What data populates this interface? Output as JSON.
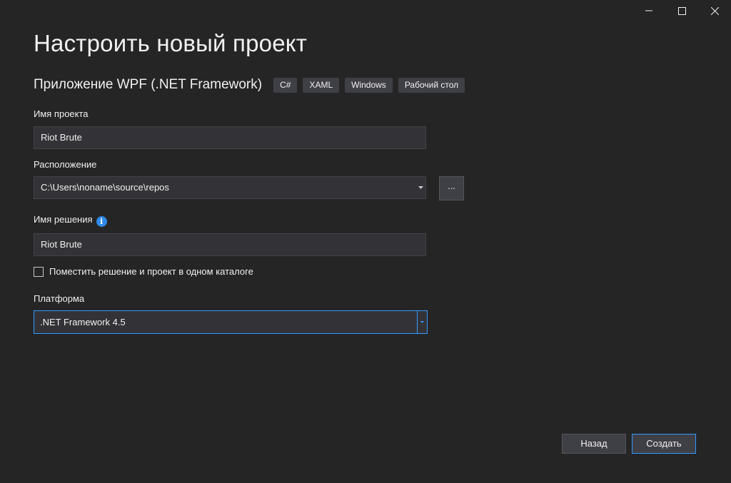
{
  "window": {
    "controls": [
      "minimize",
      "maximize",
      "close"
    ]
  },
  "page_title": "Настроить новый проект",
  "template": {
    "name": "Приложение WPF (.NET Framework)",
    "tags": [
      "C#",
      "XAML",
      "Windows",
      "Рабочий стол"
    ]
  },
  "project_name": {
    "label": "Имя проекта",
    "value": "Riot Brute"
  },
  "location": {
    "label": "Расположение",
    "value": "C:\\Users\\noname\\source\\repos",
    "browse_label": "..."
  },
  "solution_name": {
    "label": "Имя решения",
    "info_icon": "i",
    "value": "Riot Brute"
  },
  "same_directory": {
    "label": "Поместить решение и проект в одном каталоге",
    "checked": false
  },
  "platform": {
    "label": "Платформа",
    "value": ".NET Framework 4.5"
  },
  "buttons": {
    "back": "Назад",
    "create": "Создать"
  },
  "colors": {
    "background": "#252526",
    "field": "#333337",
    "accent": "#3399ff",
    "info": "#2e8ae6"
  }
}
